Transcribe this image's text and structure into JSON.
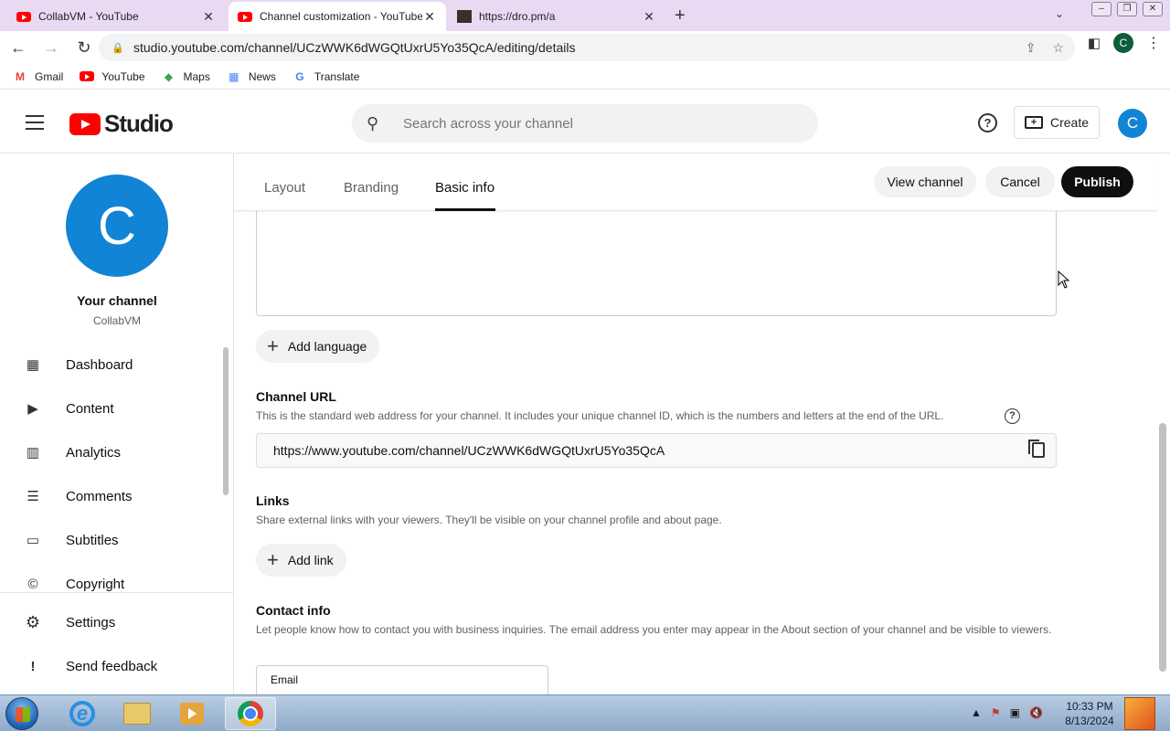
{
  "browser": {
    "tabs": [
      {
        "title": "CollabVM - YouTube",
        "icon": "youtube-favicon"
      },
      {
        "title": "Channel customization - YouTube Studio",
        "icon": "youtube-favicon"
      },
      {
        "title": "https://dro.pm/a",
        "icon": "dro-favicon"
      }
    ],
    "new_tab_label": "+",
    "url": "studio.youtube.com/channel/UCzWWK6dWGQtUxrU5Yo35QcA/editing/details",
    "profile_initial": "C",
    "bookmarks": [
      {
        "label": "Gmail",
        "icon": "gmail-icon",
        "glyph": "M",
        "color": "#ea4335"
      },
      {
        "label": "YouTube",
        "icon": "youtube-icon",
        "glyph": "▶",
        "color": "#ff0000"
      },
      {
        "label": "Maps",
        "icon": "maps-icon",
        "glyph": "◆",
        "color": "#34a853"
      },
      {
        "label": "News",
        "icon": "news-icon",
        "glyph": "▦",
        "color": "#4285f4"
      },
      {
        "label": "Translate",
        "icon": "translate-icon",
        "glyph": "G",
        "color": "#4285f4"
      }
    ]
  },
  "header": {
    "logo_text": "Studio",
    "search_placeholder": "Search across your channel",
    "create_label": "Create",
    "avatar_initial": "C"
  },
  "sidebar": {
    "avatar_initial": "C",
    "your_channel": "Your channel",
    "channel_name": "CollabVM",
    "items": [
      {
        "label": "Dashboard",
        "icon": "dashboard-icon",
        "glyph": "▦"
      },
      {
        "label": "Content",
        "icon": "content-icon",
        "glyph": "▶"
      },
      {
        "label": "Analytics",
        "icon": "analytics-icon",
        "glyph": "▥"
      },
      {
        "label": "Comments",
        "icon": "comments-icon",
        "glyph": "☰"
      },
      {
        "label": "Subtitles",
        "icon": "subtitles-icon",
        "glyph": "▭"
      },
      {
        "label": "Copyright",
        "icon": "copyright-icon",
        "glyph": "©"
      }
    ],
    "bottom_items": [
      {
        "label": "Settings",
        "icon": "gear-icon",
        "glyph": "⚙"
      },
      {
        "label": "Send feedback",
        "icon": "feedback-icon",
        "glyph": "!"
      }
    ]
  },
  "tabs": {
    "layout": "Layout",
    "branding": "Branding",
    "basic_info": "Basic info",
    "active": "Basic info"
  },
  "actions": {
    "view_channel": "View channel",
    "cancel": "Cancel",
    "publish": "Publish"
  },
  "main": {
    "add_language": "Add language",
    "channel_url": {
      "title": "Channel URL",
      "description": "This is the standard web address for your channel. It includes your unique channel ID, which is the numbers and letters at the end of the URL.",
      "value": "https://www.youtube.com/channel/UCzWWK6dWGQtUxrU5Yo35QcA"
    },
    "links": {
      "title": "Links",
      "description": "Share external links with your viewers. They'll be visible on your channel profile and about page.",
      "add_link": "Add link"
    },
    "contact_info": {
      "title": "Contact info",
      "description": "Let people know how to contact you with business inquiries. The email address you enter may appear in the About section of your channel and be visible to viewers.",
      "email_label": "Email"
    }
  },
  "taskbar": {
    "time": "10:33 PM",
    "date": "8/13/2024",
    "apps": [
      "internet-explorer",
      "windows-explorer",
      "media-player",
      "chrome"
    ]
  }
}
